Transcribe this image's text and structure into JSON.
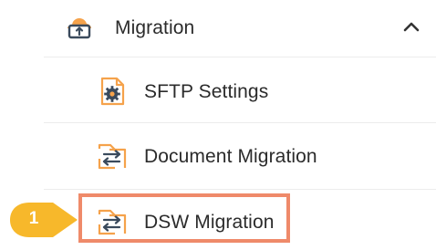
{
  "menu": {
    "section": {
      "label": "Migration",
      "icon": "cloud-upload-icon",
      "toggle_icon": "chevron-up-icon",
      "expanded": true
    },
    "items": [
      {
        "label": "SFTP Settings",
        "icon": "file-gear-icon"
      },
      {
        "label": "Document Migration",
        "icon": "file-transfer-icon"
      },
      {
        "label": "DSW Migration",
        "icon": "file-transfer-icon",
        "highlighted": true
      }
    ]
  },
  "callout": {
    "number": "1"
  },
  "colors": {
    "icon_orange": "#f5a24b",
    "highlight_border": "#ef8a6a",
    "badge_fill": "#f7b82b",
    "text": "#2b2b2b",
    "divider": "#ececec"
  }
}
